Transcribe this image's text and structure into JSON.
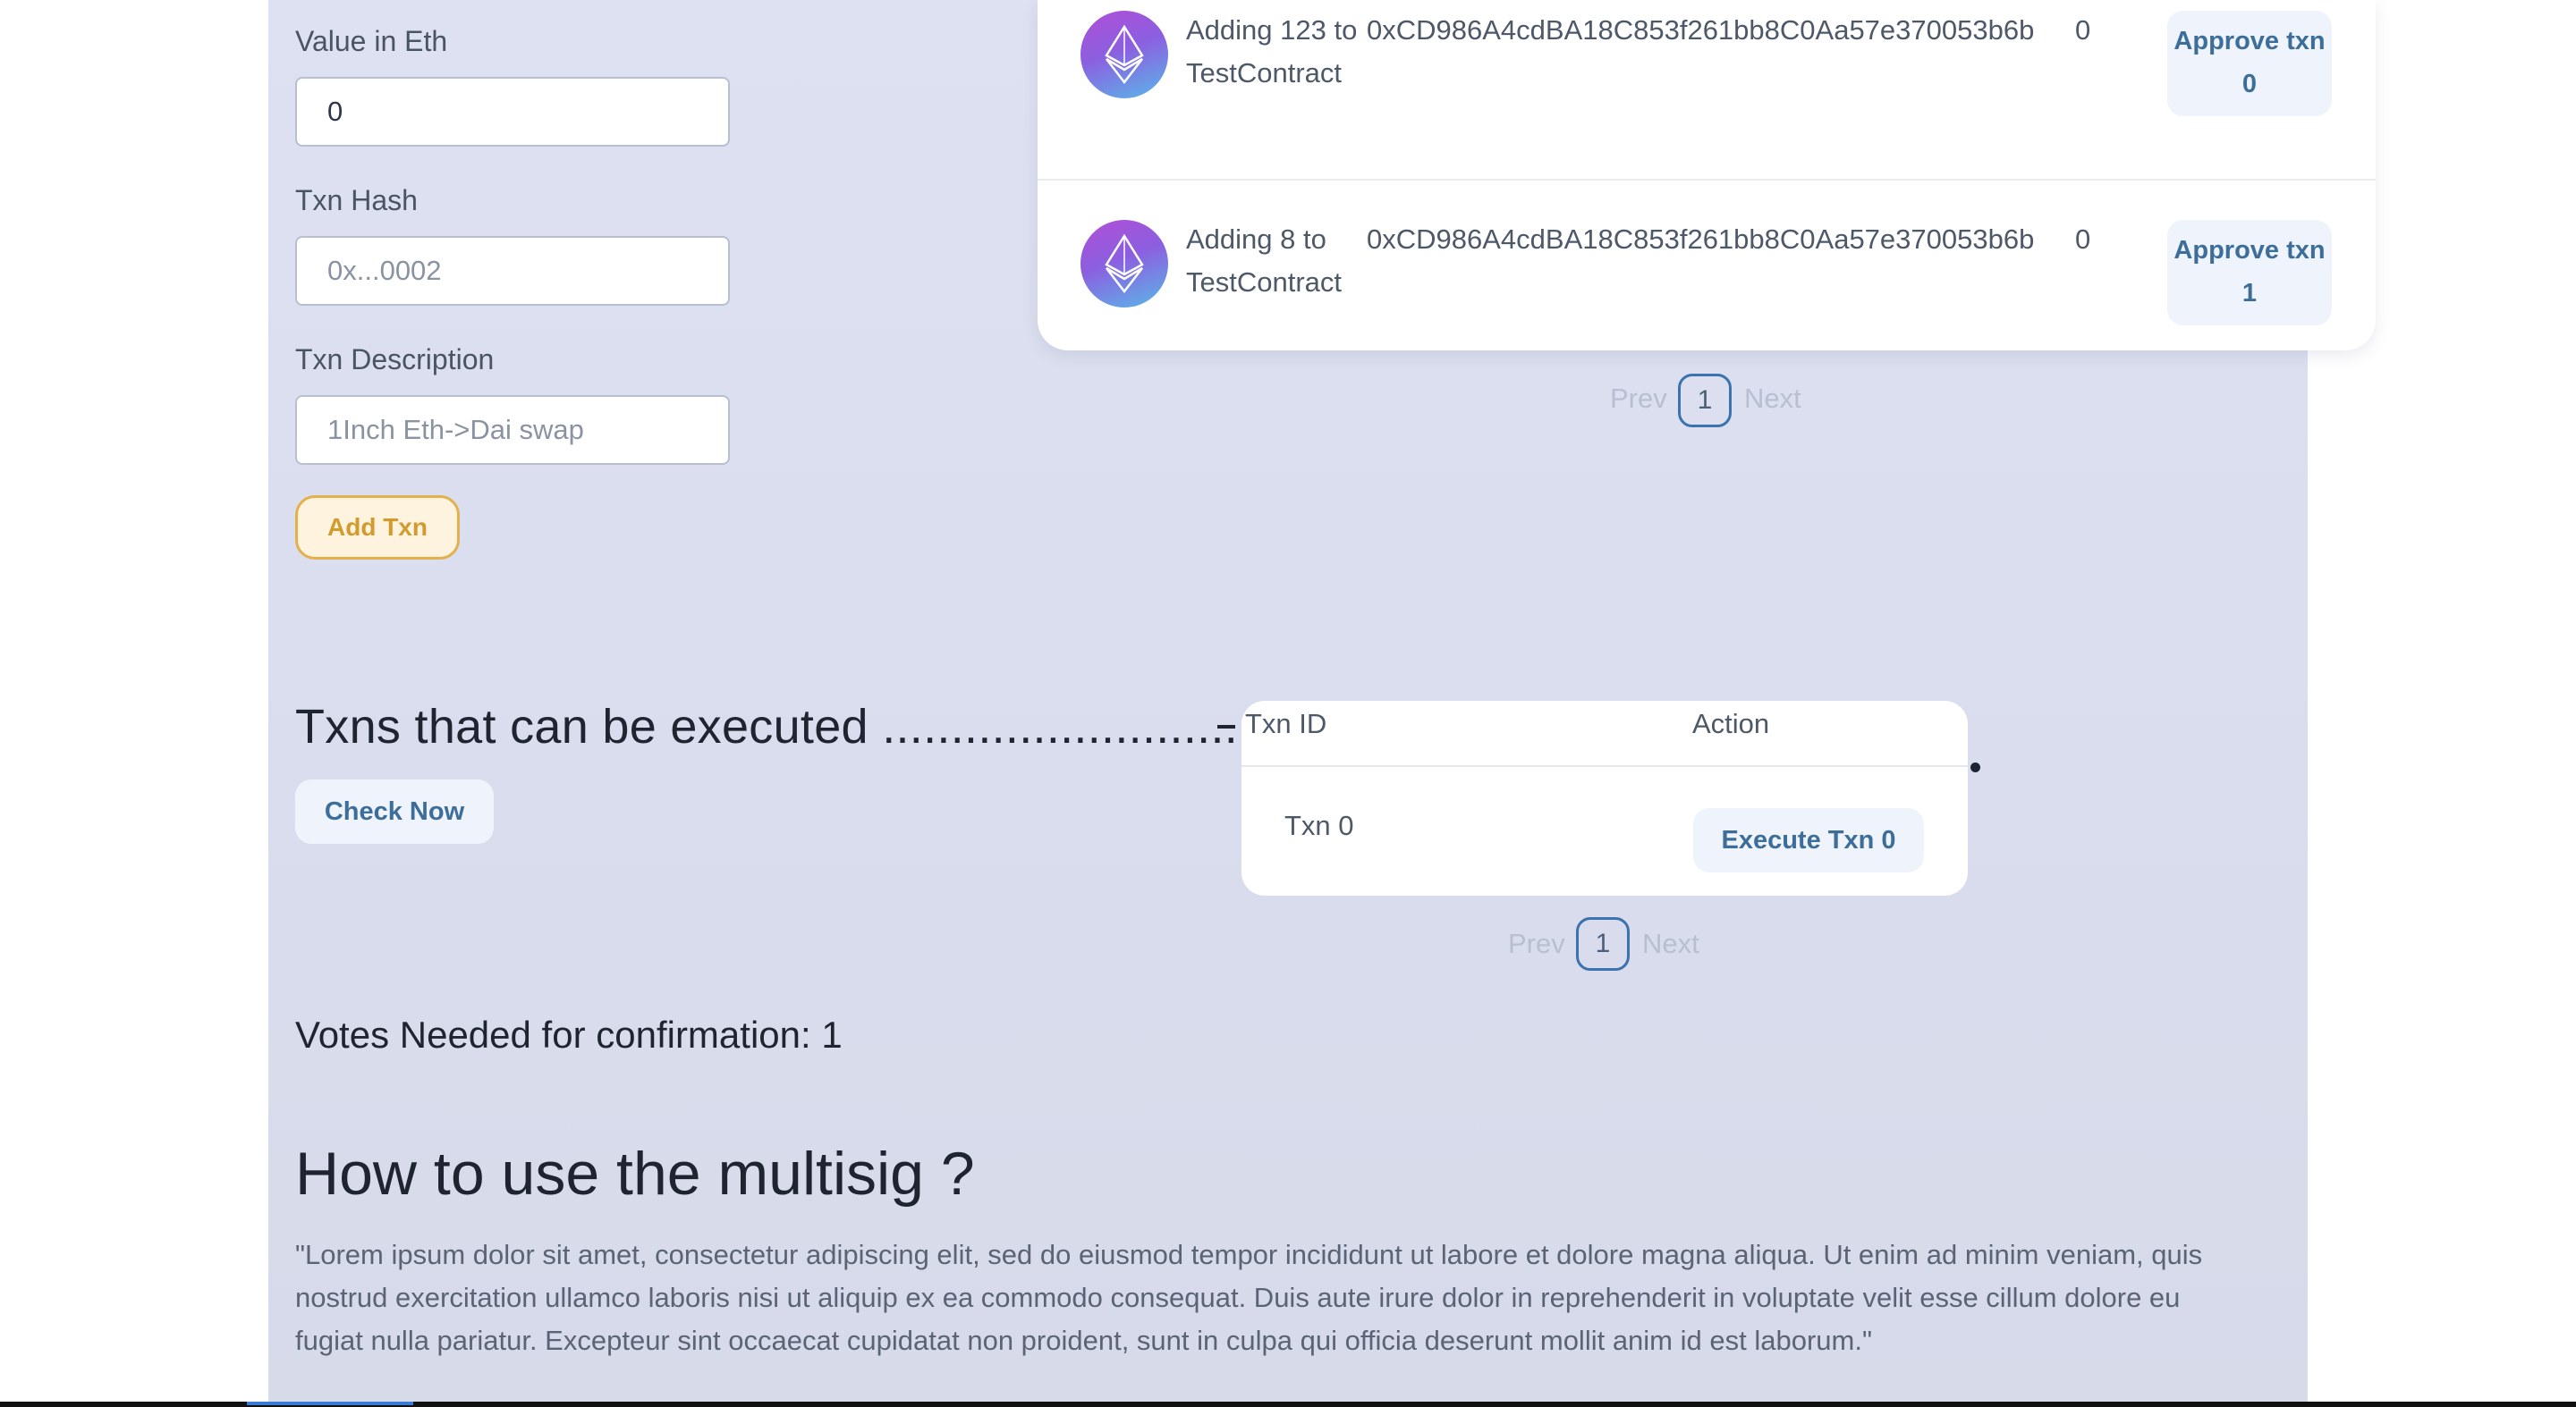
{
  "form": {
    "value_label": "Value in Eth",
    "value_input": "0",
    "hash_label": "Txn Hash",
    "hash_placeholder": "0x...0002",
    "desc_label": "Txn Description",
    "desc_placeholder": "1Inch Eth->Dai swap",
    "add_button": "Add Txn"
  },
  "pending_txns": {
    "rows": [
      {
        "description": "Adding 123 to TestContract",
        "address": "0xCD986A4cdBA18C853f261bb8C0Aa57e370053b6b",
        "value": "0",
        "approve_label": "Approve txn 0",
        "icon": "ethereum-icon"
      },
      {
        "description": "Adding 8 to TestContract",
        "address": "0xCD986A4cdBA18C853f261bb8C0Aa57e370053b6b",
        "value": "0",
        "approve_label": "Approve txn 1",
        "icon": "ethereum-icon"
      }
    ],
    "pagination": {
      "prev": "Prev",
      "page": "1",
      "next": "Next"
    }
  },
  "executable": {
    "heading": "Txns that can be executed ..................................",
    "check_button": "Check Now",
    "table": {
      "col_id": "Txn ID",
      "col_action": "Action",
      "rows": [
        {
          "id": "Txn 0",
          "action": "Execute Txn 0"
        }
      ]
    },
    "pagination": {
      "prev": "Prev",
      "page": "1",
      "next": "Next"
    }
  },
  "votes_needed": "Votes Needed for confirmation: 1",
  "howto": {
    "title": "How to use the multisig ?",
    "body": "\"Lorem ipsum dolor sit amet, consectetur adipiscing elit, sed do eiusmod tempor incididunt ut labore et dolore magna aliqua. Ut enim ad minim veniam, quis nostrud exercitation ullamco laboris nisi ut aliquip ex ea commodo consequat. Duis aute irure dolor in reprehenderit in voluptate velit esse cillum dolore eu fugiat nulla pariatur. Excepteur sint occaecat cupidatat non proident, sunt in culpa qui officia deserunt mollit anim id est laborum.\""
  },
  "colors": {
    "panel_bg": "#dde1f1",
    "accent_blue": "#3d6e99",
    "add_button_border": "#e3b04b"
  }
}
